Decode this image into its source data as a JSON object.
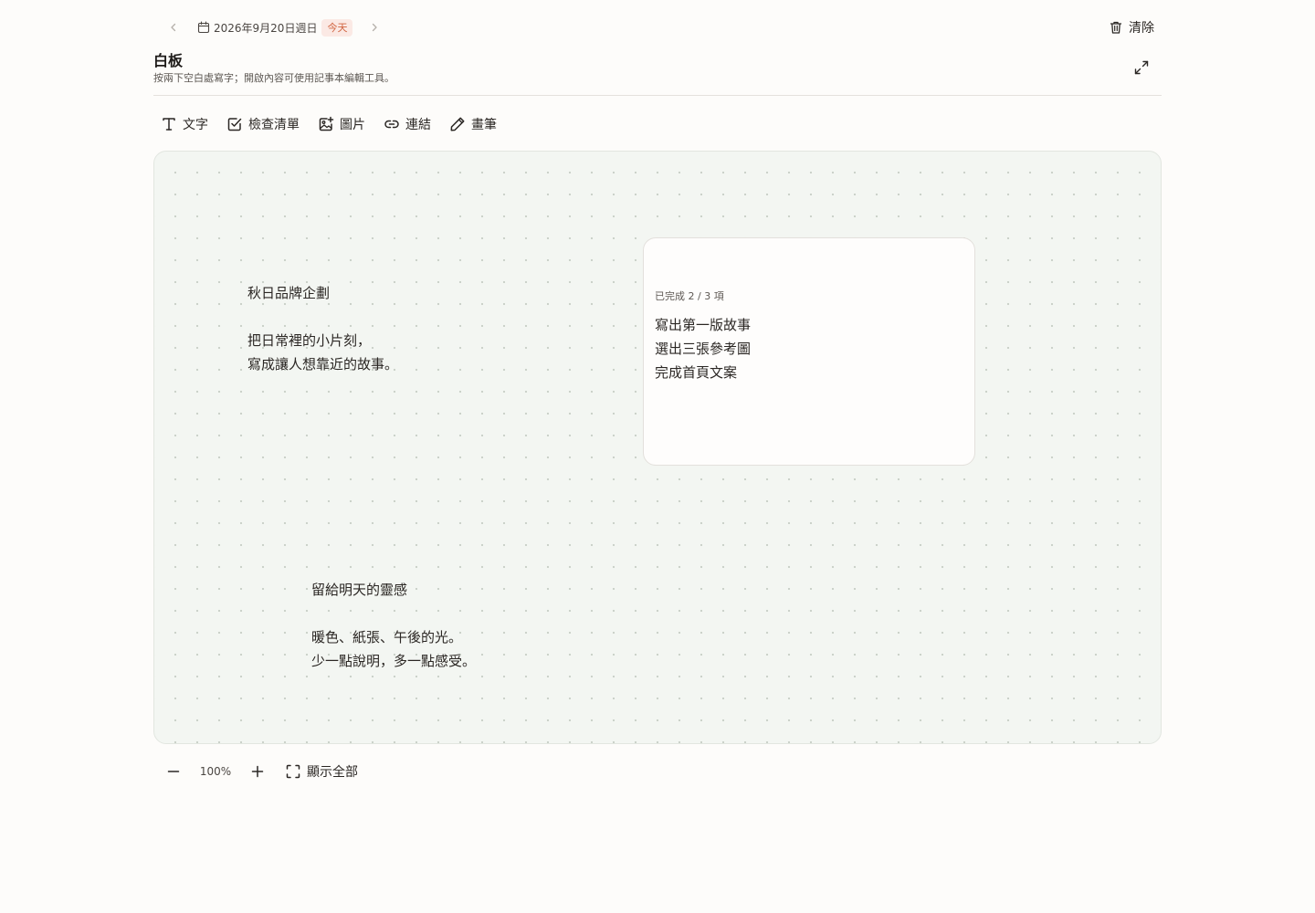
{
  "topbar": {
    "date_label": "2026年9月20日週日",
    "today_badge": "今天",
    "clear_label": "清除",
    "icons": [
      "chevron-left-icon",
      "calendar-icon",
      "chevron-right-icon",
      "trash-icon"
    ]
  },
  "header": {
    "title": "白板",
    "subtitle": "按兩下空白處寫字；開啟內容可使用記事本編輯工具。",
    "icons": [
      "expand-icon"
    ]
  },
  "toolbar": {
    "tools": [
      {
        "label": "文字",
        "icon": "text-icon"
      },
      {
        "label": "檢查清單",
        "icon": "checkbox-icon"
      },
      {
        "label": "圖片",
        "icon": "image-icon"
      },
      {
        "label": "連結",
        "icon": "link-icon"
      },
      {
        "label": "畫筆",
        "icon": "pencil-icon"
      }
    ]
  },
  "canvas": {
    "notes": [
      {
        "lines": [
          "秋日品牌企劃",
          "",
          "把日常裡的小片刻，",
          "寫成讓人想靠近的故事。"
        ]
      },
      {
        "lines": [
          "留給明天的靈感",
          "",
          "暖色、紙張、午後的光。",
          "少一點說明，多一點感受。"
        ]
      }
    ],
    "checklist": {
      "progress": "已完成 2 / 3 項",
      "items": [
        "寫出第一版故事",
        "選出三張參考圖",
        "完成首頁文案"
      ]
    }
  },
  "zoom": {
    "level": "100%",
    "fit_label": "顯示全部",
    "icons": [
      "minus-icon",
      "plus-icon",
      "fit-screen-icon"
    ]
  },
  "colors": {
    "page_background": "#fdfcfa",
    "canvas_background": "#f3f6f2",
    "today_badge_bg": "#fbe9e4",
    "today_badge_text": "#d0633f",
    "text_primary": "#2b2724"
  }
}
